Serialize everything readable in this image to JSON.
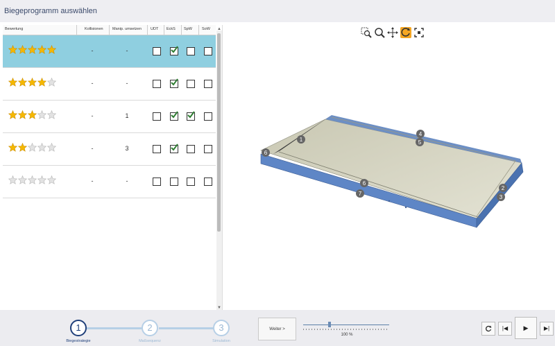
{
  "window": {
    "title": "Biegeprogramm auswählen"
  },
  "grid": {
    "columns": [
      "Bewertung",
      "Kollisionen",
      "Manip. umsetzen",
      "UDT",
      "EckS",
      "SpW",
      "SoW"
    ],
    "rows": [
      {
        "rating": 5,
        "kollisionen": "-",
        "manip": "-",
        "udt": false,
        "ecks": true,
        "spw": false,
        "sow": false,
        "selected": true
      },
      {
        "rating": 4,
        "kollisionen": "-",
        "manip": "-",
        "udt": false,
        "ecks": true,
        "spw": false,
        "sow": false,
        "selected": false
      },
      {
        "rating": 3,
        "kollisionen": "-",
        "manip": "1",
        "udt": false,
        "ecks": true,
        "spw": true,
        "sow": false,
        "selected": false
      },
      {
        "rating": 2,
        "kollisionen": "-",
        "manip": "3",
        "udt": false,
        "ecks": true,
        "spw": false,
        "sow": false,
        "selected": false
      },
      {
        "rating": 0,
        "kollisionen": "-",
        "manip": "-",
        "udt": false,
        "ecks": false,
        "spw": false,
        "sow": false,
        "selected": false
      }
    ]
  },
  "viewer": {
    "tools": [
      "zoom-window-icon",
      "zoom-icon",
      "pan-icon",
      "rotate-icon",
      "fit-view-icon"
    ],
    "active_tool": "rotate-icon",
    "markers": [
      {
        "label": "1"
      },
      {
        "label": "2"
      },
      {
        "label": "3"
      },
      {
        "label": "4"
      },
      {
        "label": "5"
      },
      {
        "label": "6"
      },
      {
        "label": "6"
      },
      {
        "label": "7"
      }
    ]
  },
  "wizard": {
    "steps": [
      {
        "number": "1",
        "label": "Biegestrategie",
        "active": true
      },
      {
        "number": "2",
        "label": "Maßsequenz",
        "active": false
      },
      {
        "number": "3",
        "label": "Simulation",
        "active": false
      }
    ]
  },
  "controls": {
    "next_label": "Weiter >",
    "zoom_label": "100 %",
    "slider_fraction": 0.3
  },
  "player": {
    "buttons": [
      "refresh-icon",
      "skip-back-icon",
      "play-icon",
      "skip-forward-icon"
    ]
  },
  "colors": {
    "accent": "#1f3f7a",
    "selection": "#8fcfe0",
    "active_tool": "#f5a623",
    "part_blue": "#5e86c6"
  }
}
